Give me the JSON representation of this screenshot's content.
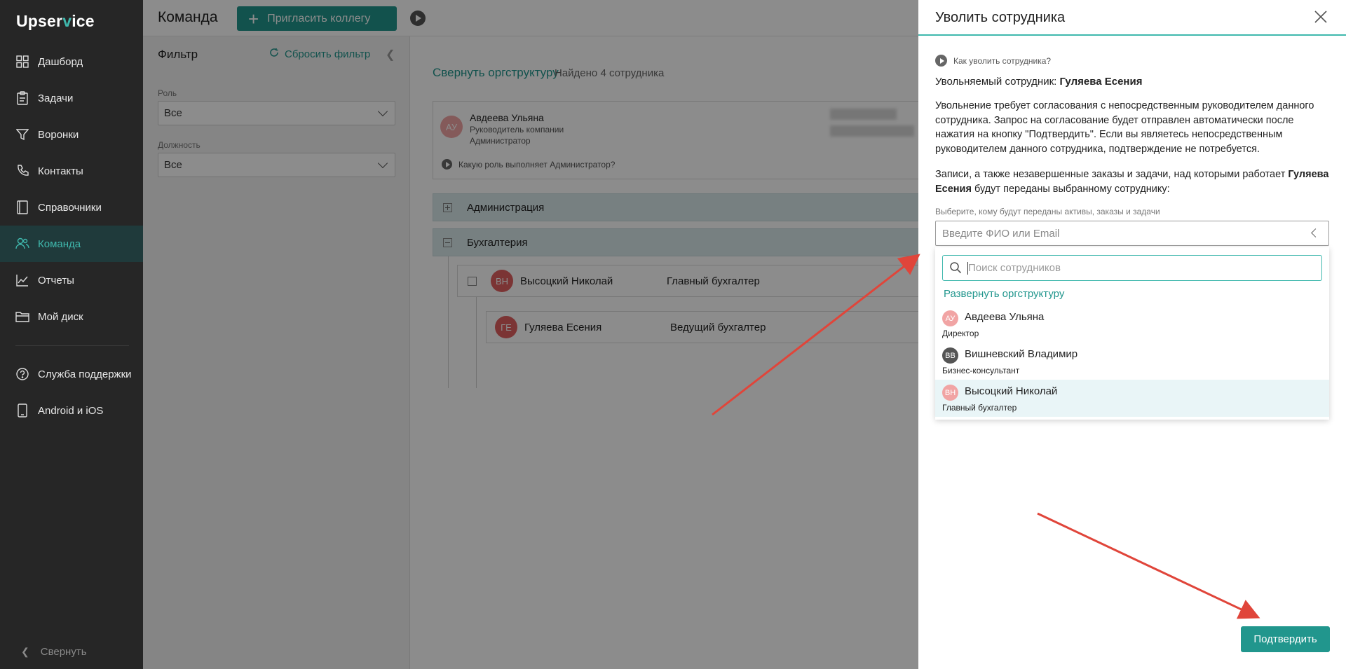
{
  "app": {
    "logo_left": "Upser",
    "logo_mark": "v",
    "logo_right": "ice"
  },
  "sidebar": {
    "items": [
      {
        "label": "Дашборд",
        "icon": "grid-icon"
      },
      {
        "label": "Задачи",
        "icon": "clipboard-icon"
      },
      {
        "label": "Воронки",
        "icon": "funnel-icon"
      },
      {
        "label": "Контакты",
        "icon": "phone-icon"
      },
      {
        "label": "Справочники",
        "icon": "book-icon"
      },
      {
        "label": "Команда",
        "icon": "team-icon",
        "active": true
      },
      {
        "label": "Отчеты",
        "icon": "chart-icon"
      },
      {
        "label": "Мой диск",
        "icon": "folder-icon"
      },
      {
        "label": "Служба поддержки",
        "icon": "help-icon"
      },
      {
        "label": "Android и iOS",
        "icon": "mobile-icon"
      }
    ],
    "collapse_label": "Свернуть"
  },
  "header": {
    "title": "Команда",
    "invite_label": "Пригласить коллегу"
  },
  "filter": {
    "title": "Фильтр",
    "reset_label": "Сбросить фильтр",
    "role_label": "Роль",
    "role_value": "Все",
    "position_label": "Должность",
    "position_value": "Все"
  },
  "org": {
    "collapse_label": "Свернуть оргструктуру",
    "found_label": "Найдено 4 сотрудника",
    "director": {
      "initials": "АУ",
      "name": "Авдеева Ульяна",
      "title": "Руководитель компании",
      "role": "Администратор",
      "role_question": "Какую роль выполняет Администратор?"
    },
    "departments": [
      {
        "name": "Администрация"
      },
      {
        "name": "Бухгалтерия"
      }
    ],
    "employees": [
      {
        "initials": "ВН",
        "name": "Высоцкий Николай",
        "position": "Главный бухгалтер"
      },
      {
        "initials": "ГЕ",
        "name": "Гуляева Есения",
        "position": "Ведущий бухгалтер"
      }
    ]
  },
  "drawer": {
    "title": "Уволить сотрудника",
    "howto_label": "Как уволить сотрудника?",
    "fired_prefix": "Увольняемый сотрудник: ",
    "fired_name": "Гуляева Есения",
    "para1": "Увольнение требует согласования с непосредственным руководителем данного сотрудника. Запрос на согласование будет отправлен автоматически после нажатия на кнопку \"Подтвердить\". Если вы являетесь непосредственным руководителем данного сотрудника, подтверждение не потребуется.",
    "para2_prefix": "Записи, а также незавершенные заказы и задачи, над которыми работает ",
    "para2_name": "Гуляева Есения",
    "para2_suffix": " будут переданы выбранному сотруднику:",
    "assign_label": "Выберите, кому будут переданы активы, заказы и задачи",
    "assign_placeholder": "Введите ФИО или Email",
    "search_placeholder": "Поиск сотрудников",
    "expand_org_label": "Развернуть оргструктуру",
    "options": [
      {
        "initials": "АУ",
        "name": "Авдеева Ульяна",
        "role": "Директор",
        "color": "#f1a4a4"
      },
      {
        "initials": "ВВ",
        "name": "Вишневский Владимир",
        "role": "Бизнес-консультант",
        "color": "#555555"
      },
      {
        "initials": "ВН",
        "name": "Высоцкий Николай",
        "role": "Главный бухгалтер",
        "color": "#f1a4a4",
        "highlighted": true
      }
    ],
    "confirm_label": "Подтвердить"
  },
  "colors": {
    "accent": "#21968d",
    "sidebar_bg": "#262626",
    "annotation_arrow": "#e0453a"
  }
}
